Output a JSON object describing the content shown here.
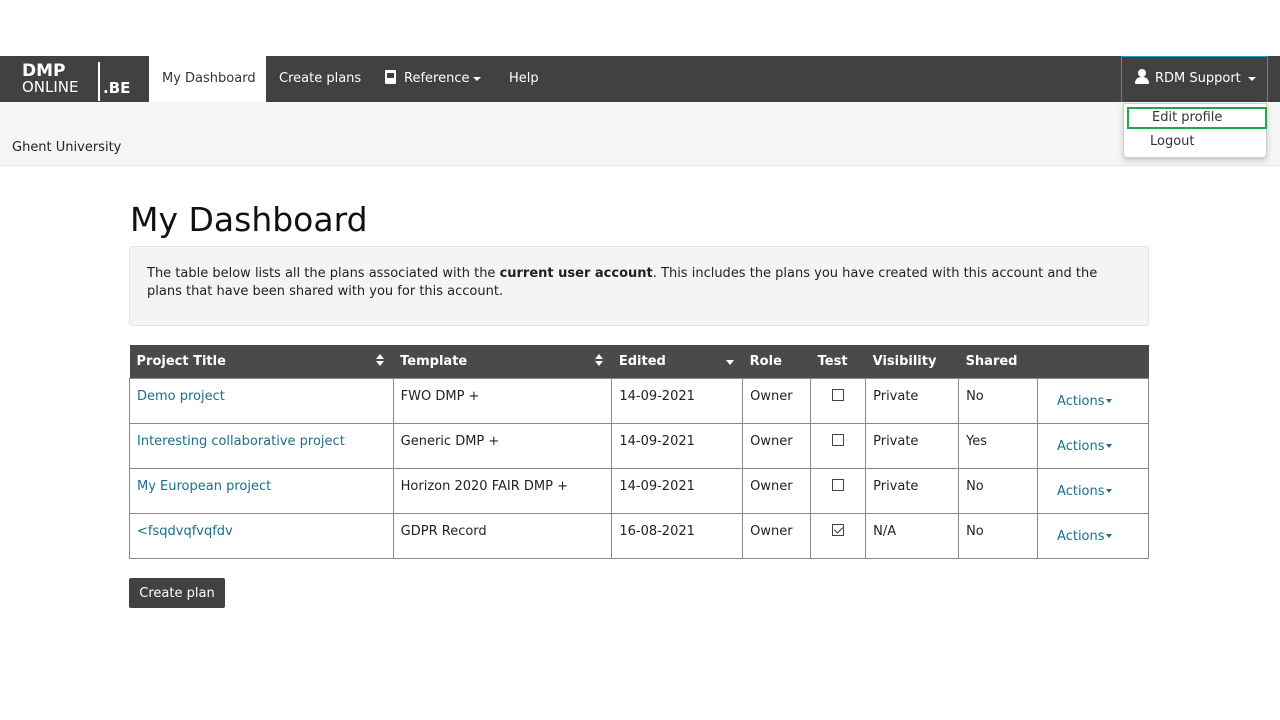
{
  "logo": {
    "line1": "DMP",
    "line2": "ONLINE",
    "suffix": ".BE"
  },
  "nav": {
    "items": [
      {
        "label": "My Dashboard",
        "active": true
      },
      {
        "label": "Create plans"
      },
      {
        "label": "Reference",
        "dropdown": true,
        "icon": "book-icon"
      },
      {
        "label": "Help"
      }
    ],
    "user": {
      "label": "RDM Support",
      "icon": "user-icon"
    },
    "user_menu": [
      {
        "label": "Edit profile",
        "highlighted": true
      },
      {
        "label": "Logout"
      }
    ]
  },
  "org": {
    "name": "Ghent University"
  },
  "page": {
    "title": "My Dashboard",
    "info_before": "The table below lists all the plans associated with the ",
    "info_bold": "current user account",
    "info_after": ". This includes the plans you have created with this account and the plans that have been shared with you for this account."
  },
  "table": {
    "headers": {
      "title": "Project Title",
      "template": "Template",
      "edited": "Edited",
      "role": "Role",
      "test": "Test",
      "visibility": "Visibility",
      "shared": "Shared"
    },
    "rows": [
      {
        "title": "Demo project",
        "template": "FWO DMP +",
        "edited": "14-09-2021",
        "role": "Owner",
        "test": false,
        "visibility": "Private",
        "shared": "No",
        "actions": "Actions"
      },
      {
        "title": "Interesting collaborative project",
        "template": "Generic DMP +",
        "edited": "14-09-2021",
        "role": "Owner",
        "test": false,
        "visibility": "Private",
        "shared": "Yes",
        "actions": "Actions"
      },
      {
        "title": "My European project",
        "template": "Horizon 2020 FAIR DMP +",
        "edited": "14-09-2021",
        "role": "Owner",
        "test": false,
        "visibility": "Private",
        "shared": "No",
        "actions": "Actions"
      },
      {
        "title": "<fsqdvqfvqfdv",
        "template": "GDPR Record",
        "edited": "16-08-2021",
        "role": "Owner",
        "test": true,
        "visibility": "N/A",
        "shared": "No",
        "actions": "Actions"
      }
    ]
  },
  "buttons": {
    "create_plan": "Create plan"
  },
  "colors": {
    "navbar": "#414141",
    "link": "#1a6f8a",
    "highlight": "#21a64a",
    "user_menu_border": "#1ba0c4"
  }
}
